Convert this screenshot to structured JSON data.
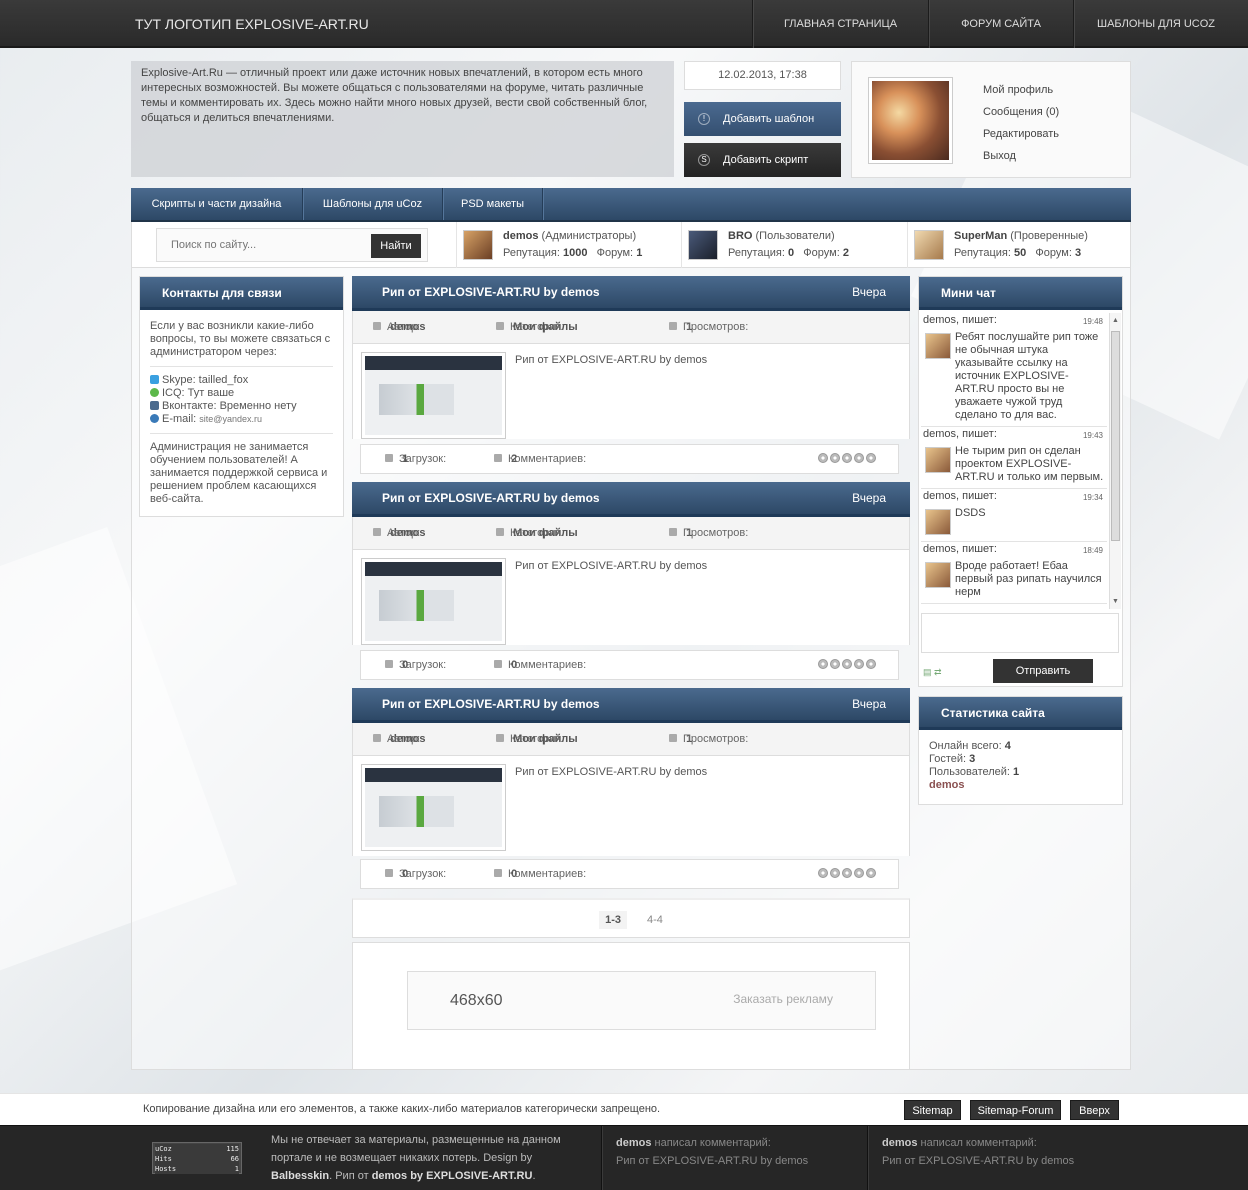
{
  "topbar": {
    "logo": "ТУТ ЛОГОТИП EXPLOSIVE-ART.RU",
    "nav": [
      "ГЛАВНАЯ СТРАНИЦА",
      "ФОРУМ САЙТА",
      "ШАБЛОНЫ ДЛЯ UCOZ"
    ]
  },
  "header": {
    "about": "Explosive-Art.Ru — отличный проект или даже источник новых впечатлений, в котором есть много интересных возможностей. Вы можете общаться с пользователями на форуме, читать различные темы и комментировать их. Здесь можно найти много новых друзей, вести свой собственный блог, общаться и делиться впечатлениями.",
    "date": "12.02.2013, 17:38",
    "add_template": "Добавить шаблон",
    "add_script": "Добавить скрипт",
    "profile_links": [
      "Мой профиль",
      "Сообщения (0)",
      "Редактировать",
      "Выход"
    ]
  },
  "mainnav": [
    "Скрипты и части дизайна",
    "Шаблоны для uCoz",
    "PSD макеты"
  ],
  "search": {
    "placeholder": "Поиск по сайту...",
    "button": "Найти"
  },
  "top_users": [
    {
      "name": "demos",
      "group": "(Администраторы)",
      "rep_label": "Репутация:",
      "rep": "1000",
      "forum_label": "Форум:",
      "forum": "1"
    },
    {
      "name": "BRO",
      "group": "(Пользователи)",
      "rep_label": "Репутация:",
      "rep": "0",
      "forum_label": "Форум:",
      "forum": "2"
    },
    {
      "name": "SuperMan",
      "group": "(Проверенные)",
      "rep_label": "Репутация:",
      "rep": "50",
      "forum_label": "Форум:",
      "forum": "3"
    }
  ],
  "contacts": {
    "title": "Контакты для связи",
    "intro": "Если у вас возникли какие-либо вопросы, то вы можете связаться с администратором через:",
    "skype": "Skype: tailled_fox",
    "icq": "ICQ: Тут ваше",
    "vk": "Вконтакте: Временно нету",
    "email_label": "E-mail:",
    "email": "site@yandex.ru",
    "note": "Администрация не занимается обучением пользователей! А занимается поддержкой сервиса и решением проблем касающихся веб-сайта."
  },
  "posts": [
    {
      "title": "Рип от EXPLOSIVE-ART.RU by demos",
      "when": "Вчера",
      "author_label": "Автор:",
      "author": "demos",
      "cat_label": "Категория:",
      "category": "Мои файлы",
      "views_label": "Просмотров:",
      "views": "1",
      "text": "Рип от EXPLOSIVE-ART.RU by demos",
      "dl_label": "Загрузок:",
      "downloads": "1",
      "com_label": "Комментариев:",
      "comments": "2"
    },
    {
      "title": "Рип от EXPLOSIVE-ART.RU by demos",
      "when": "Вчера",
      "author_label": "Автор:",
      "author": "demos",
      "cat_label": "Категория:",
      "category": "Мои файлы",
      "views_label": "Просмотров:",
      "views": "1",
      "text": "Рип от EXPLOSIVE-ART.RU by demos",
      "dl_label": "Загрузок:",
      "downloads": "0",
      "com_label": "Комментариев:",
      "comments": "0"
    },
    {
      "title": "Рип от EXPLOSIVE-ART.RU by demos",
      "when": "Вчера",
      "author_label": "Автор:",
      "author": "demos",
      "cat_label": "Категория:",
      "category": "Мои файлы",
      "views_label": "Просмотров:",
      "views": "1",
      "text": "Рип от EXPLOSIVE-ART.RU by demos",
      "dl_label": "Загрузок:",
      "downloads": "0",
      "com_label": "Комментариев:",
      "comments": "0"
    }
  ],
  "pager": {
    "current": "1-3",
    "next": "4-4"
  },
  "ad": {
    "size": "468x60",
    "order": "Заказать рекламу"
  },
  "chat": {
    "title": "Мини чат",
    "messages": [
      {
        "who": "demos, пишет:",
        "time": "19:48",
        "text": "Ребят послушайте рип тоже не обычная штука указывайте ссылку на источник EXPLOSIVE-ART.RU просто вы не уважаете чужой труд сделано то для вас."
      },
      {
        "who": "demos, пишет:",
        "time": "19:43",
        "text": "Не тырим рип он сделан проектом EXPLOSIVE-ART.RU и только им первым."
      },
      {
        "who": "demos, пишет:",
        "time": "19:34",
        "text": "DSDS"
      },
      {
        "who": "demos, пишет:",
        "time": "18:49",
        "text": "Вроде работает! Ебаа первый раз рипать научился нерм"
      }
    ],
    "send": "Отправить"
  },
  "stats": {
    "title": "Статистика сайта",
    "online_label": "Онлайн всего:",
    "online": "4",
    "guests_label": "Гостей:",
    "guests": "3",
    "users_label": "Пользователей:",
    "users": "1",
    "user": "demos"
  },
  "copyright": {
    "text": "Копирование дизайна или его элементов, а также каких-либо материалов категорически запрещено.",
    "buttons": [
      "Sitemap",
      "Sitemap-Forum",
      "Вверх"
    ]
  },
  "footer": {
    "counter": {
      "brand": "uCoz",
      "r1_label": "",
      "r1": "115",
      "r2_label": "Hits",
      "r2": "66",
      "r3_label": "Hosts",
      "r3": "1"
    },
    "line1": "Мы не отвечает за материалы, размещенные на данном портале и не возмещает никаких потерь. Design by",
    "designer": "Balbesskin",
    "line2": ". Рип от",
    "ripper": "demos by EXPLOSIVE-ART.RU",
    "line3": ".",
    "recent": [
      {
        "who": "demos",
        "action": "написал комментарий:",
        "text": "Рип от EXPLOSIVE-ART.RU by demos"
      },
      {
        "who": "demos",
        "action": "написал комментарий:",
        "text": "Рип от EXPLOSIVE-ART.RU by demos"
      }
    ]
  }
}
